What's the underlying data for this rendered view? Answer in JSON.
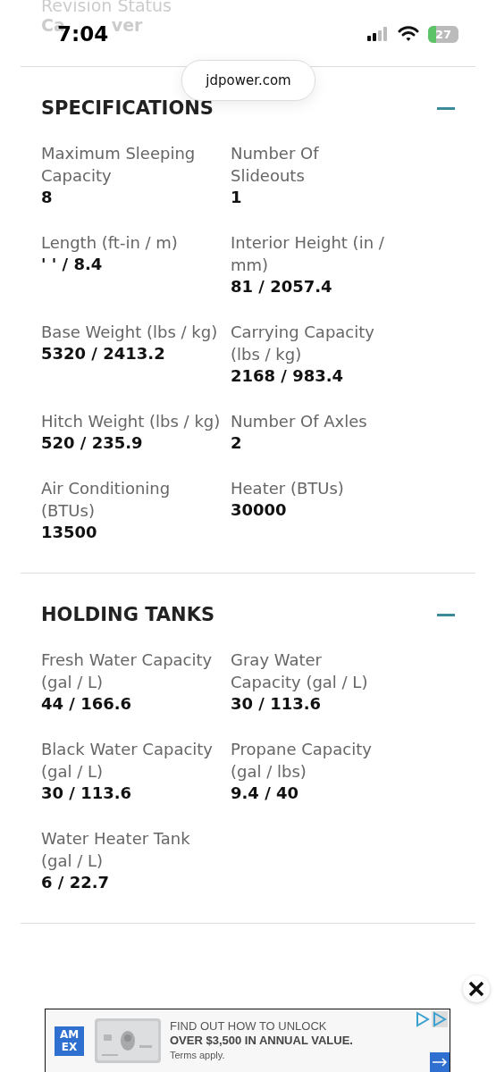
{
  "status_bar": {
    "time": "7:04",
    "battery": "27"
  },
  "address_bar": {
    "url": "jdpower.com"
  },
  "previous_field": {
    "label": "Revision Status",
    "value_start": "Ca",
    "value_end": "ver"
  },
  "sections": [
    {
      "title": "SPECIFICATIONS",
      "expanded": true,
      "fields": [
        {
          "label": "Maximum Sleeping Capacity",
          "value": "8"
        },
        {
          "label": "Number Of Slideouts",
          "value": "1"
        },
        {
          "label": "Length (ft-in / m)",
          "value": "' ' / 8.4"
        },
        {
          "label": "Interior Height (in / mm)",
          "value": "81 / 2057.4"
        },
        {
          "label": "Base Weight (lbs / kg)",
          "value": "5320 / 2413.2"
        },
        {
          "label": "Carrying Capacity (lbs / kg)",
          "value": "2168 / 983.4"
        },
        {
          "label": "Hitch Weight (lbs / kg)",
          "value": "520 / 235.9"
        },
        {
          "label": "Number Of Axles",
          "value": "2"
        },
        {
          "label": "Air Conditioning (BTUs)",
          "value": "13500"
        },
        {
          "label": "Heater (BTUs)",
          "value": "30000"
        }
      ]
    },
    {
      "title": "HOLDING TANKS",
      "expanded": true,
      "fields": [
        {
          "label": "Fresh Water Capacity (gal / L)",
          "value": "44 / 166.6"
        },
        {
          "label": "Gray Water Capacity (gal / L)",
          "value": "30 / 113.6"
        },
        {
          "label": "Black Water Capacity (gal / L)",
          "value": "30 / 113.6"
        },
        {
          "label": "Propane Capacity (gal / lbs)",
          "value": "9.4 / 40"
        },
        {
          "label": "Water Heater Tank (gal / L)",
          "value": "6 / 22.7"
        }
      ]
    }
  ],
  "ad": {
    "logo": "AM EX",
    "headline": "FIND OUT HOW TO UNLOCK",
    "offer": "OVER $3,500 IN ANNUAL VALUE.",
    "terms": "Terms apply."
  }
}
